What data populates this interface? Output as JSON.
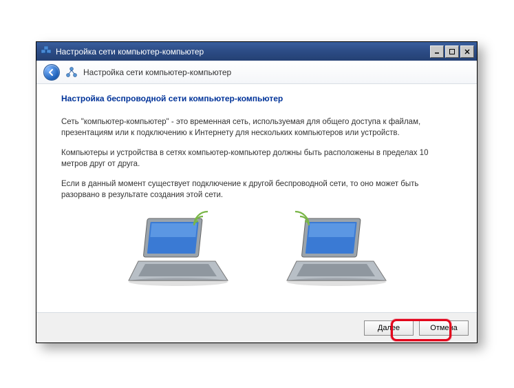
{
  "window": {
    "title": "Настройка сети компьютер-компьютер"
  },
  "header": {
    "title": "Настройка сети компьютер-компьютер"
  },
  "content": {
    "heading": "Настройка беспроводной сети компьютер-компьютер",
    "para1": "Сеть \"компьютер-компьютер\" - это временная сеть, используемая для общего доступа к файлам, презентациям или к подключению к Интернету для нескольких компьютеров или устройств.",
    "para2": "Компьютеры и устройства в сетях компьютер-компьютер должны быть расположены в пределах 10 метров друг от друга.",
    "para3": "Если в данный момент существует подключение к другой беспроводной сети, то оно может быть разорвано в результате создания этой сети."
  },
  "footer": {
    "next": "Далее",
    "cancel": "Отмена"
  }
}
